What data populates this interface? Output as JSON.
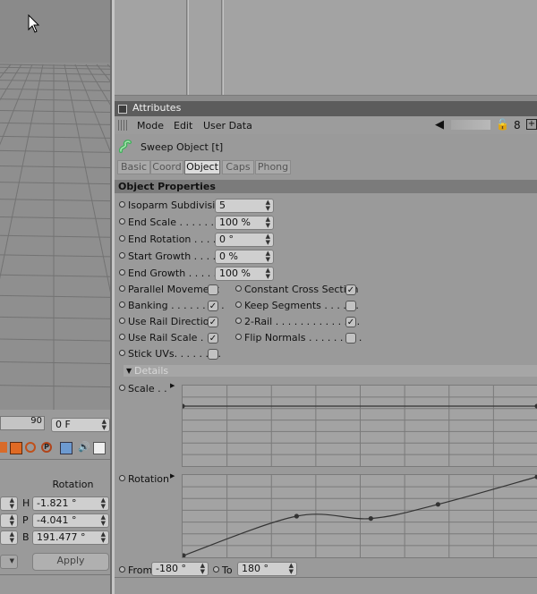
{
  "viewport": {
    "timeline_number": "90",
    "frame_field": "0 F"
  },
  "coords": {
    "rotation_header": "Rotation",
    "rows": [
      {
        "label": "H",
        "value": "-1.821 °"
      },
      {
        "label": "P",
        "value": "-4.041 °"
      },
      {
        "label": "B",
        "value": "191.477 °"
      }
    ],
    "apply_label": "Apply"
  },
  "attributes": {
    "panel_title": "Attributes",
    "menu": [
      "Mode",
      "Edit",
      "User Data"
    ],
    "object_name": "Sweep Object [t]",
    "tabs": [
      {
        "label": "Basic",
        "active": false
      },
      {
        "label": "Coord",
        "active": false
      },
      {
        "label": "Object",
        "active": true
      },
      {
        "label": "Caps",
        "active": false
      },
      {
        "label": "Phong",
        "active": false
      }
    ],
    "section_title": "Object Properties",
    "fields": [
      {
        "label": "Isoparm Subdivision",
        "value": "5"
      },
      {
        "label": "End Scale . . . . . . . .",
        "value": "100 %"
      },
      {
        "label": "End Rotation . . . . .",
        "value": "0 °"
      },
      {
        "label": "Start Growth . . . . . .",
        "value": "0 %"
      },
      {
        "label": "End Growth . . . . . . .",
        "value": "100 %"
      }
    ],
    "checks_left": [
      {
        "label": "Parallel Movement",
        "checked": false
      },
      {
        "label": "Banking . . . . . . . . .",
        "checked": true
      },
      {
        "label": "Use Rail Direction",
        "checked": true
      },
      {
        "label": "Use Rail Scale . . .",
        "checked": true
      },
      {
        "label": "Stick UVs. . . . . . . .",
        "checked": false
      }
    ],
    "checks_right": [
      {
        "label": "Constant Cross Section",
        "checked": true
      },
      {
        "label": "Keep Segments . . . . . .",
        "checked": false
      },
      {
        "label": "2-Rail . . . . . . . . . . . . . .",
        "checked": true
      },
      {
        "label": "Flip Normals . . . . . . . . .",
        "checked": false
      }
    ],
    "details_label": "Details",
    "scale_label": "Scale . .",
    "rotation_label": "Rotation",
    "from_label": "From",
    "from_value": "-180 °",
    "to_label": "To",
    "to_value": "180 °",
    "rotation_curve": [
      [
        0,
        0
      ],
      [
        0.32,
        0.5
      ],
      [
        0.53,
        0.47
      ],
      [
        0.72,
        0.65
      ],
      [
        1,
        1
      ]
    ],
    "scale_level": 0.5
  }
}
